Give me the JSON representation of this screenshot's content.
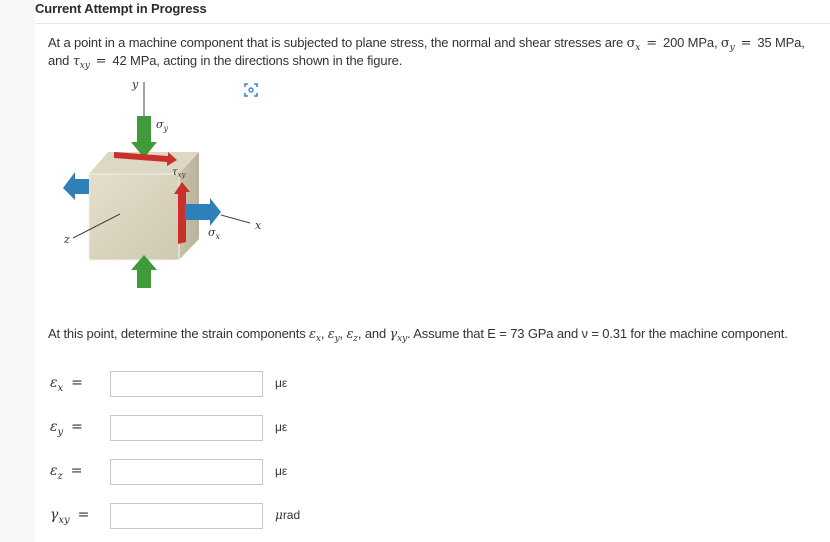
{
  "header": {
    "title": "Current Attempt in Progress"
  },
  "problem": {
    "intro_prefix": "At a point in a machine component that is subjected to plane stress, the normal and shear stresses are",
    "sigma_x_label": "σ",
    "sigma_x_sub": "x",
    "sigma_x_value": "200 MPa,",
    "sigma_y_label": "σ",
    "sigma_y_sub": "y",
    "sigma_y_value": "35 MPa,",
    "line2_prefix": "and",
    "tau_label": "τ",
    "tau_sub": "xy",
    "tau_value": "42 MPa, acting in the directions shown in the figure.",
    "equals": "="
  },
  "figure": {
    "axis_y": "y",
    "axis_x": "x",
    "axis_z": "z",
    "sigma_y": "σ",
    "sigma_y_sub": "y",
    "sigma_x": "σ",
    "sigma_x_sub": "x",
    "tau": "τ",
    "tau_sub": "xy",
    "zoom_icon": "zoom-in-icon",
    "colors": {
      "cube": "#d8d2bd",
      "green": "#3f9a3a",
      "red": "#c9302c",
      "blue": "#2f7fb8"
    }
  },
  "question": {
    "prefix": "At this point, determine the strain components",
    "eps": "ε",
    "x": "x",
    "y": "y",
    "z": "z",
    "and": "and",
    "gamma": "γ",
    "xy": "xy",
    "suffix": ". Assume that E = 73 GPa and ν = 0.31 for the machine component."
  },
  "answers": [
    {
      "symbol": "ε",
      "sub": "x",
      "eq": "=",
      "value": "",
      "placeholder": "",
      "unit": "με"
    },
    {
      "symbol": "ε",
      "sub": "y",
      "eq": "=",
      "value": "",
      "placeholder": "",
      "unit": "με"
    },
    {
      "symbol": "ε",
      "sub": "z",
      "eq": "=",
      "value": "",
      "placeholder": "",
      "unit": "με"
    },
    {
      "symbol": "γ",
      "sub": "xy",
      "eq": "=",
      "value": "",
      "placeholder": "",
      "unit_prefix": "μ",
      "unit_rest": "rad"
    }
  ]
}
